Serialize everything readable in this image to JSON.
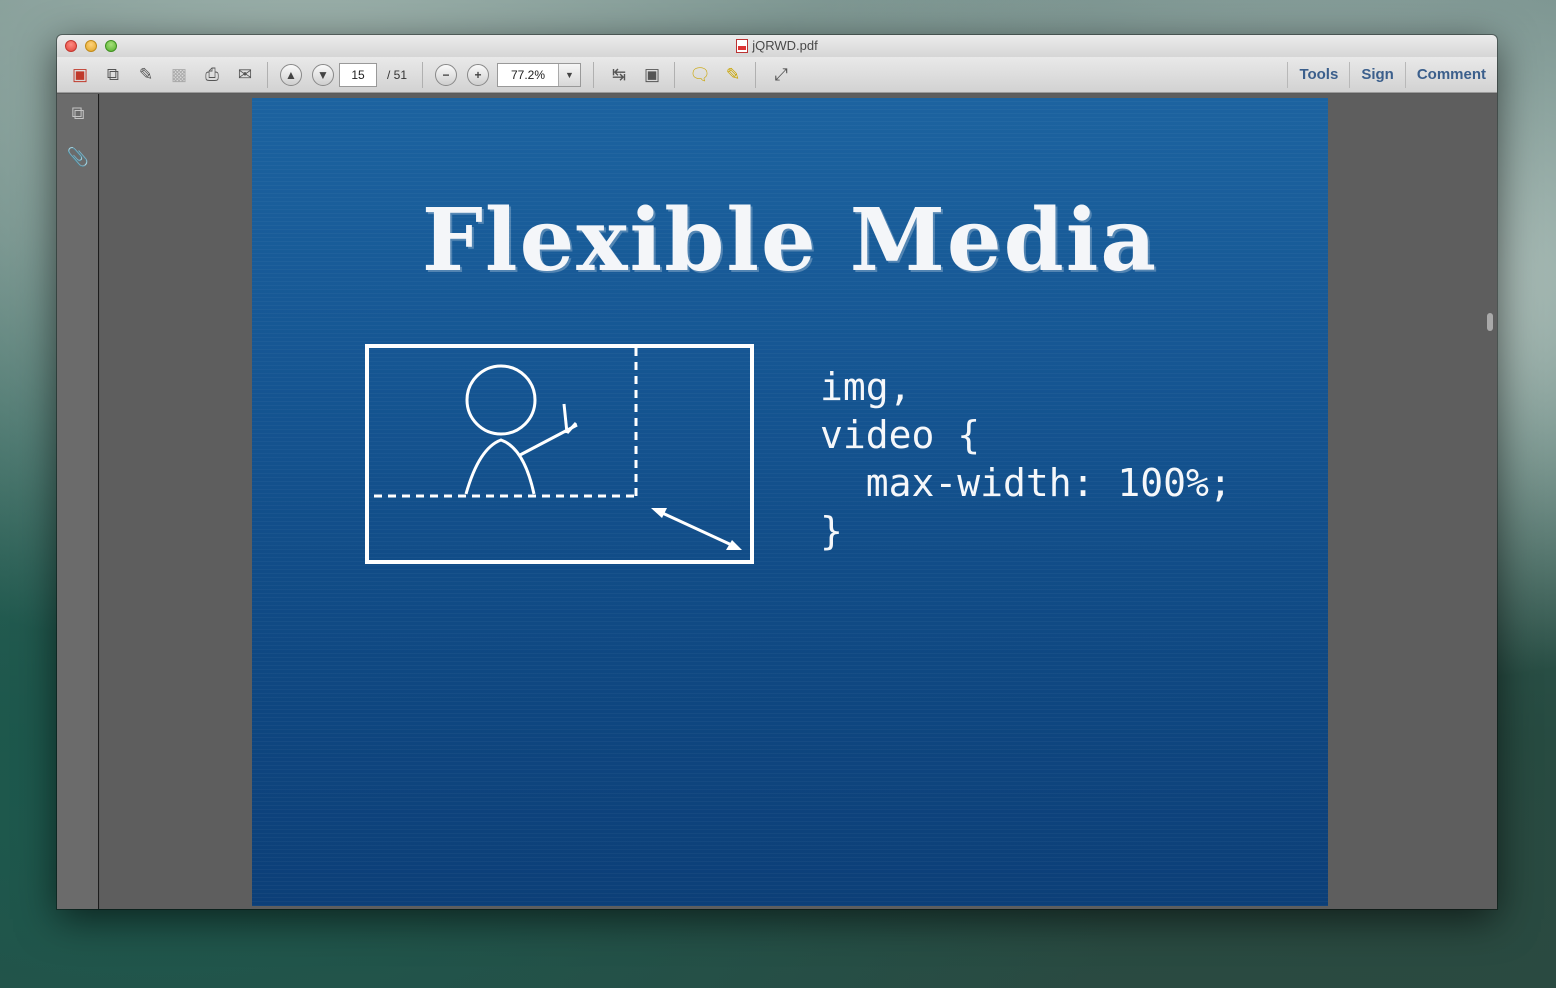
{
  "window": {
    "title": "jQRWD.pdf"
  },
  "toolbar": {
    "page_current": "15",
    "page_total": "/ 51",
    "zoom": "77.2%",
    "tabs": {
      "tools": "Tools",
      "sign": "Sign",
      "comment": "Comment"
    }
  },
  "slide": {
    "title": "Flexible Media",
    "code_lines": [
      "img,",
      "video {",
      "  max-width: 100%;",
      "}"
    ]
  },
  "colors": {
    "slide_blue": "#155592",
    "tab_text": "#3b5f8c"
  }
}
